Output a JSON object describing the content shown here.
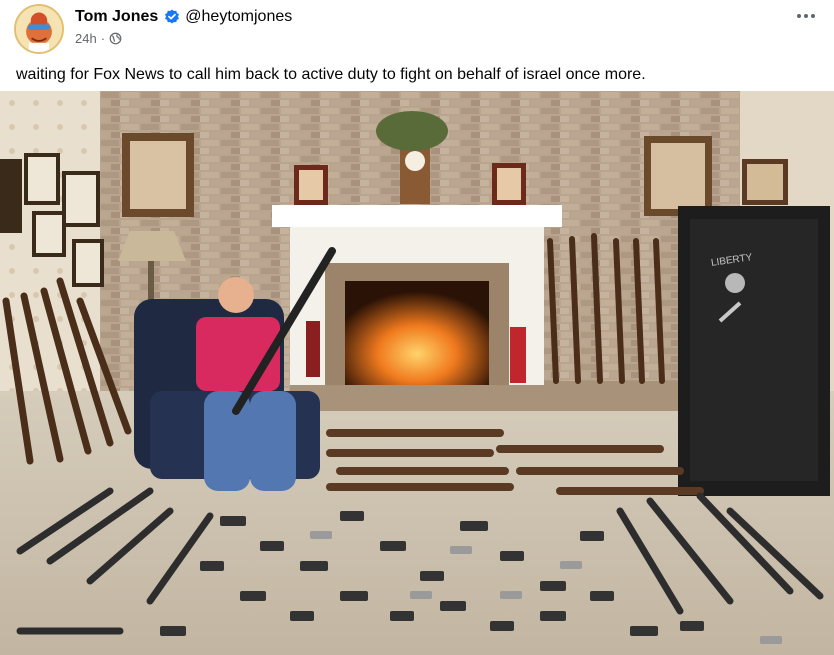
{
  "post": {
    "author": {
      "name": "Tom Jones",
      "handle": "@heytomjones",
      "verified": true,
      "avatar_icon": "cartoon-avatar-icon"
    },
    "timestamp": "24h",
    "separator": "·",
    "audience_icon": "globe-icon",
    "more_icon": "more-dots-icon",
    "caption": "waiting for Fox News to call him back to active duty to fight on behalf of israel once more.",
    "image": {
      "safe_label": "LIBERTY"
    }
  },
  "colors": {
    "name": "#050505",
    "meta": "#65676b",
    "verified": "#1877f2",
    "brick": "#b9a48f",
    "carpet": "#cfc4b2"
  }
}
